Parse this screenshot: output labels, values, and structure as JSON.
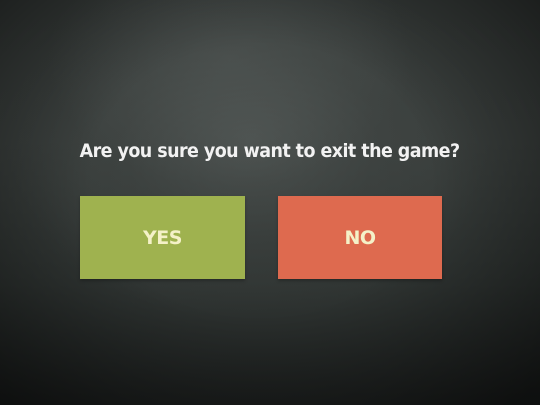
{
  "dialog": {
    "title": "Are you sure you want to exit the game?",
    "yes_label": "YES",
    "no_label": "NO"
  },
  "colors": {
    "background": "#3a3f3d",
    "yes_button": "#9fb24f",
    "no_button": "#de6a4f",
    "title_text": "#f2f2f2",
    "button_text": "#f4f1c8"
  }
}
